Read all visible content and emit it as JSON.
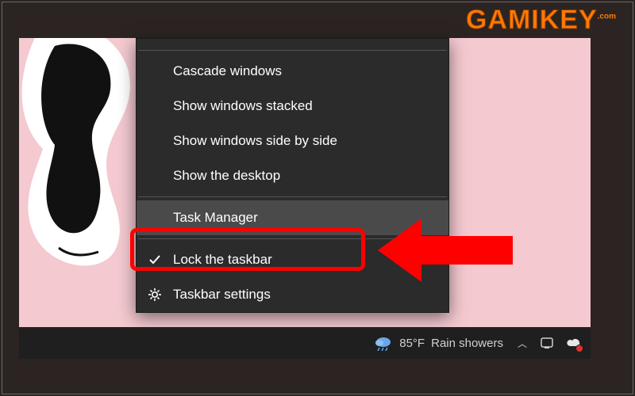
{
  "logo": {
    "text": "GAMIKEY",
    "suffix": ".com"
  },
  "menu": {
    "items": [
      {
        "label": "Cascade windows"
      },
      {
        "label": "Show windows stacked"
      },
      {
        "label": "Show windows side by side"
      },
      {
        "label": "Show the desktop"
      },
      {
        "label": "Task Manager"
      },
      {
        "label": "Lock the taskbar"
      },
      {
        "label": "Taskbar settings"
      }
    ]
  },
  "taskbar": {
    "weather_temp": "85°F",
    "weather_cond": "Rain showers"
  },
  "colors": {
    "highlight": "#ff0000",
    "menu_bg": "#2b2b2b",
    "accent": "#ff7a03"
  }
}
